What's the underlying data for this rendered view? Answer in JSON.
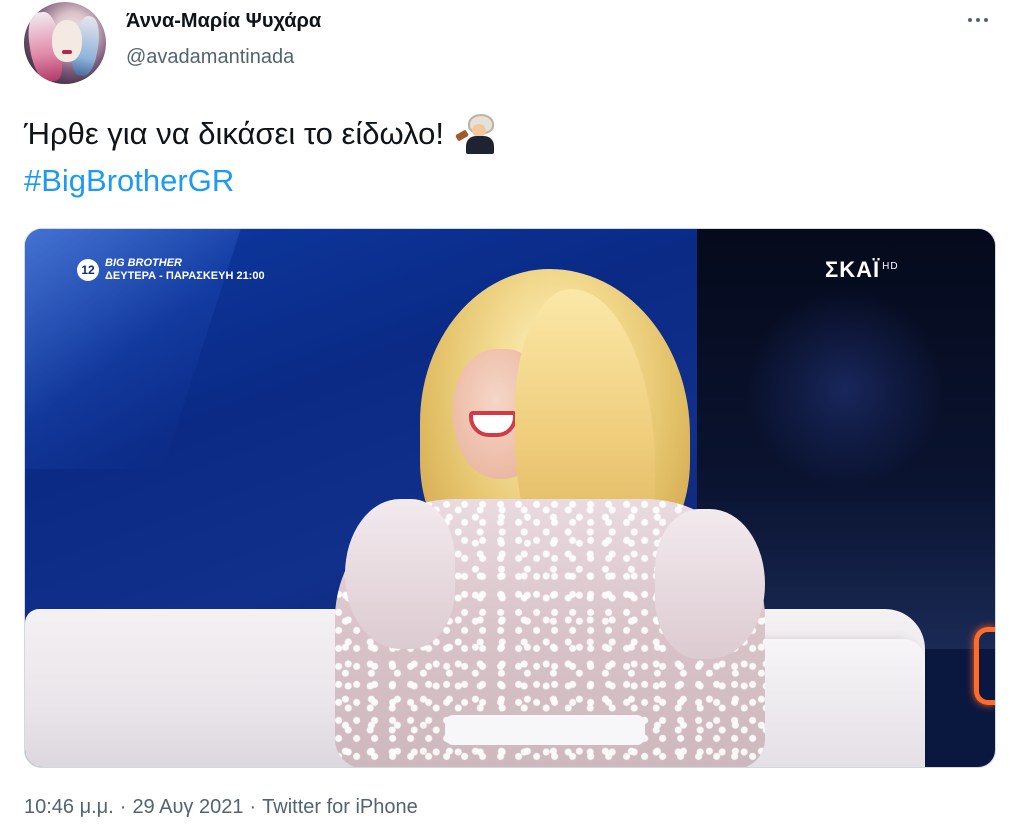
{
  "author": {
    "display_name": "Άννα-Μαρία Ψυχάρα",
    "handle": "@avadamantinada"
  },
  "tweet": {
    "text_line1": "Ήρθε για να δικάσει το είδωλο!",
    "emoji": "judge-emoji",
    "hashtag": "#BigBrotherGR"
  },
  "media": {
    "rating": "12",
    "show_title": "BIG BROTHER",
    "show_schedule": "ΔΕΥΤΕΡΑ - ΠΑΡΑΣΚΕΥΗ 21:00",
    "channel": "ΣΚΑΪ",
    "channel_suffix": "HD"
  },
  "meta": {
    "time": "10:46 μ.μ.",
    "sep1": "·",
    "date": "29 Αυγ 2021",
    "sep2": "·",
    "source": "Twitter for iPhone"
  },
  "colors": {
    "link": "#1d9bf0",
    "secondary_text": "#536471",
    "primary_text": "#0f1419"
  }
}
